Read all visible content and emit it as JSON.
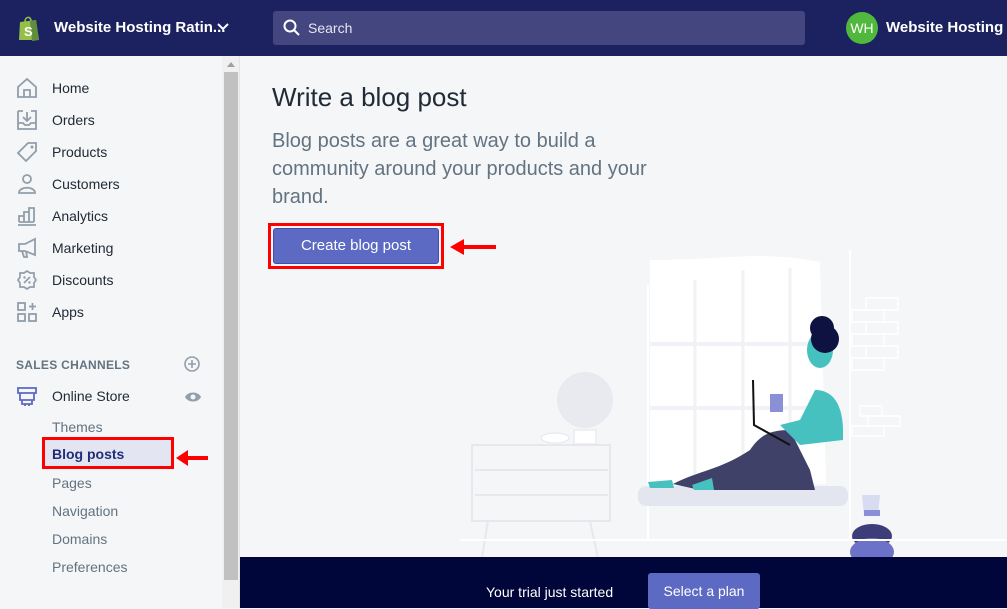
{
  "topbar": {
    "store_name": "Website Hosting Ratin...",
    "search_placeholder": "Search",
    "avatar_initials": "WH",
    "account_name": "Website Hosting",
    "colors": {
      "bar": "#1c2260",
      "search": "#43467f",
      "avatar": "#50b83c",
      "logo": "#95bf47"
    }
  },
  "sidebar": {
    "items": [
      {
        "label": "Home",
        "icon": "home-icon"
      },
      {
        "label": "Orders",
        "icon": "orders-icon"
      },
      {
        "label": "Products",
        "icon": "tag-icon"
      },
      {
        "label": "Customers",
        "icon": "person-icon"
      },
      {
        "label": "Analytics",
        "icon": "bar-chart-icon"
      },
      {
        "label": "Marketing",
        "icon": "megaphone-icon"
      },
      {
        "label": "Discounts",
        "icon": "discount-icon"
      },
      {
        "label": "Apps",
        "icon": "apps-icon"
      }
    ],
    "sales_channels_header": "SALES CHANNELS",
    "online_store_label": "Online Store",
    "sub_items": [
      {
        "label": "Themes",
        "active": false
      },
      {
        "label": "Blog posts",
        "active": true
      },
      {
        "label": "Pages",
        "active": false
      },
      {
        "label": "Navigation",
        "active": false
      },
      {
        "label": "Domains",
        "active": false
      },
      {
        "label": "Preferences",
        "active": false
      }
    ]
  },
  "main": {
    "title": "Write a blog post",
    "description": "Blog posts are a great way to build a community around your products and your brand.",
    "cta_label": "Create blog post",
    "accent": "#5c6ac4",
    "annotation_color": "#ff0000"
  },
  "trial": {
    "text": "Your trial just started",
    "button_label": "Select a plan"
  }
}
